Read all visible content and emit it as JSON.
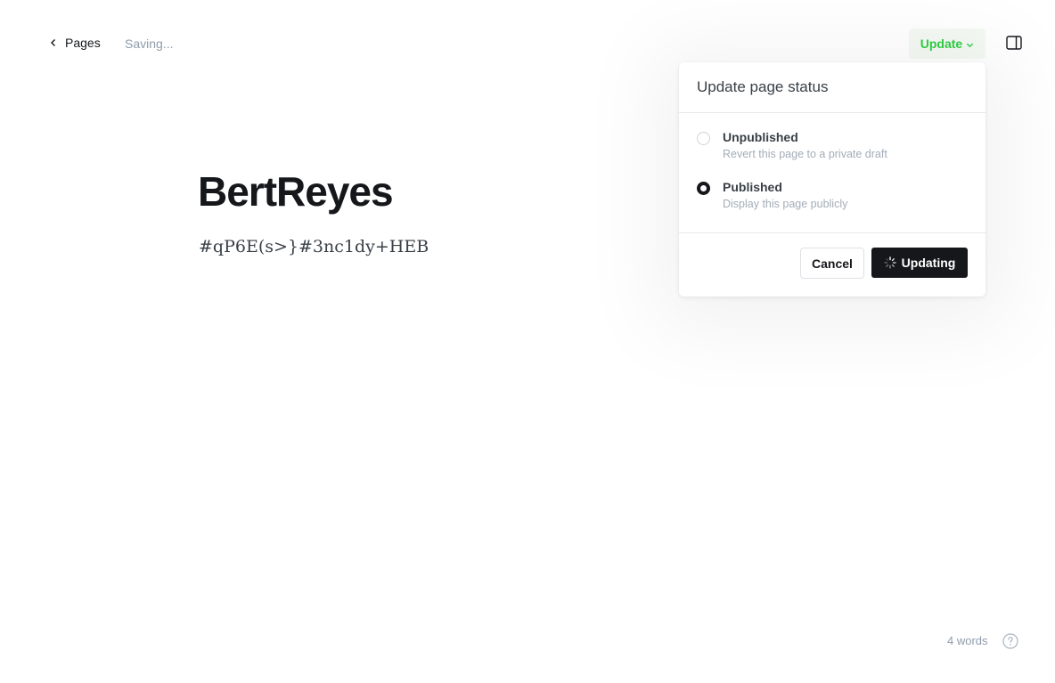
{
  "header": {
    "back_label": "Pages",
    "status": "Saving...",
    "update_label": "Update"
  },
  "editor": {
    "title": "BertReyes",
    "body": "#qP6E(s>}#3nc1dy+HEB"
  },
  "popover": {
    "title": "Update page status",
    "options": [
      {
        "label": "Unpublished",
        "description": "Revert this page to a private draft",
        "selected": false
      },
      {
        "label": "Published",
        "description": "Display this page publicly",
        "selected": true
      }
    ],
    "cancel_label": "Cancel",
    "confirm_label": "Updating"
  },
  "footer": {
    "word_count": "4 words"
  },
  "icons": {
    "back": "chevron-left-icon",
    "dropdown": "chevron-down-icon",
    "sidebar": "sidebar-toggle-icon",
    "spinner": "spinner-icon",
    "help": "help-circle-icon"
  },
  "colors": {
    "accent_green": "#30cf43",
    "dark": "#15171a",
    "muted": "#8e9cac"
  }
}
